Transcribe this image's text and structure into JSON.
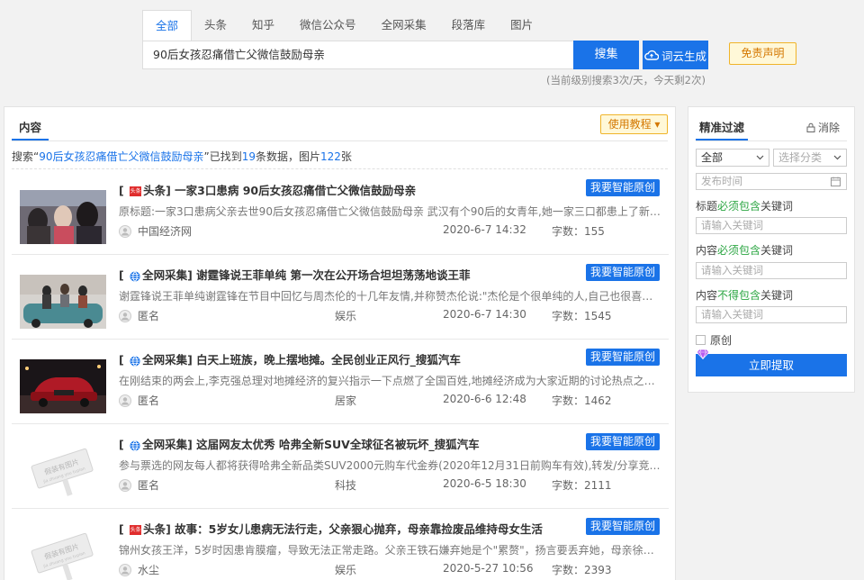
{
  "search": {
    "tabs": [
      "全部",
      "头条",
      "知乎",
      "微信公众号",
      "全网采集",
      "段落库",
      "图片"
    ],
    "active_tab": 0,
    "query": "90后女孩忍痛借亡父微信鼓励母亲",
    "search_label": "搜集",
    "wordcloud_label": "词云生成",
    "disclaimer_label": "免责声明",
    "quota_note": "(当前级别搜索3次/天，今天剩2次)"
  },
  "main": {
    "tab_label": "内容",
    "tutorial_label": "使用教程",
    "summary": {
      "prefix": "搜索“",
      "query": "90后女孩忍痛借亡父微信鼓励母亲",
      "mid": "”已找到",
      "count": "19",
      "mid2": "条数据，图片",
      "images": "122",
      "suffix": "张"
    },
    "original_label": "我要智能原创",
    "items": [
      {
        "source": "头条",
        "source_type": "toutiao",
        "title": "一家3口患病 90后女孩忍痛借亡父微信鼓励母亲",
        "desc": "原标题:一家3口患病父亲去世90后女孩忍痛借亡父微信鼓励母亲 武汉有个90后的女青年,她一家三口都患上了新冠肺炎…",
        "author": "中国经济网",
        "category": "",
        "time": "2020-6-7 14:32",
        "words": "字数：155",
        "thumb": "people"
      },
      {
        "source": "全网采集",
        "source_type": "web",
        "title": "谢霆锋说王菲单纯 第一次在公开场合坦坦荡荡地谈王菲",
        "desc": "谢霆锋说王菲单纯谢霆锋在节目中回忆与周杰伦的十几年友情,并称赞杰伦说:\"杰伦是个很单纯的人,自己也很喜欢…",
        "author": "匿名",
        "category": "娱乐",
        "time": "2020-6-7 14:30",
        "words": "字数：1545",
        "thumb": "car-group"
      },
      {
        "source": "全网采集",
        "source_type": "web",
        "title": "白天上班族，晚上摆地摊。全民创业正风行_搜狐汽车",
        "desc": "在刚结束的两会上,李克强总理对地摊经济的复兴指示一下点燃了全国百姓,地摊经济成为大家近期的讨论热点之一…",
        "author": "匿名",
        "category": "居家",
        "time": "2020-6-6 12:48",
        "words": "字数：1462",
        "thumb": "red-car"
      },
      {
        "source": "全网采集",
        "source_type": "web",
        "title": "这届网友太优秀 哈弗全新SUV全球征名被玩坏_搜狐汽车",
        "desc": "参与票选的网友每人都将获得哈弗全新品类SUV2000元购车代金券(2020年12月31日前购车有效),转发/分享竞猜活…",
        "author": "匿名",
        "category": "科技",
        "time": "2020-6-5 18:30",
        "words": "字数：2111",
        "thumb": "placeholder"
      },
      {
        "source": "头条",
        "source_type": "toutiao",
        "title": "故事：5岁女儿患病无法行走，父亲狠心抛弃，母亲靠捡废品维持母女生活",
        "desc": "锦州女孩王洋，5岁时因患肯膜瘤，导致无法正常走路。父亲王铁石嫌弃她是个\"累赘\"，扬言要丢弃她，母亲徐文…",
        "author": "水尘",
        "category": "娱乐",
        "time": "2020-5-27 10:56",
        "words": "字数：2393",
        "thumb": "placeholder"
      }
    ],
    "placeholder_text": "假装有图片",
    "placeholder_pinyin": "jia zhuang you tupian",
    "toutiao_badge_text": "头条"
  },
  "filter": {
    "title": "精准过滤",
    "clear_label": "消除",
    "scope_value": "全部",
    "category_placeholder": "选择分类",
    "date_placeholder": "发布时间",
    "title_label": [
      "标题",
      "必须包含",
      "关键词"
    ],
    "content_label": [
      "内容",
      "必须包含",
      "关键词"
    ],
    "exclude_label": [
      "内容",
      "不得包含",
      "关键词"
    ],
    "keyword_placeholder": "请输入关键词",
    "original_label": "原创",
    "extract_label": "立即提取"
  },
  "colors": {
    "primary": "#1a73e8",
    "accent_orange": "#f0b429",
    "toutiao_red": "#e02d2d",
    "keyword_green": "#2aa541"
  }
}
